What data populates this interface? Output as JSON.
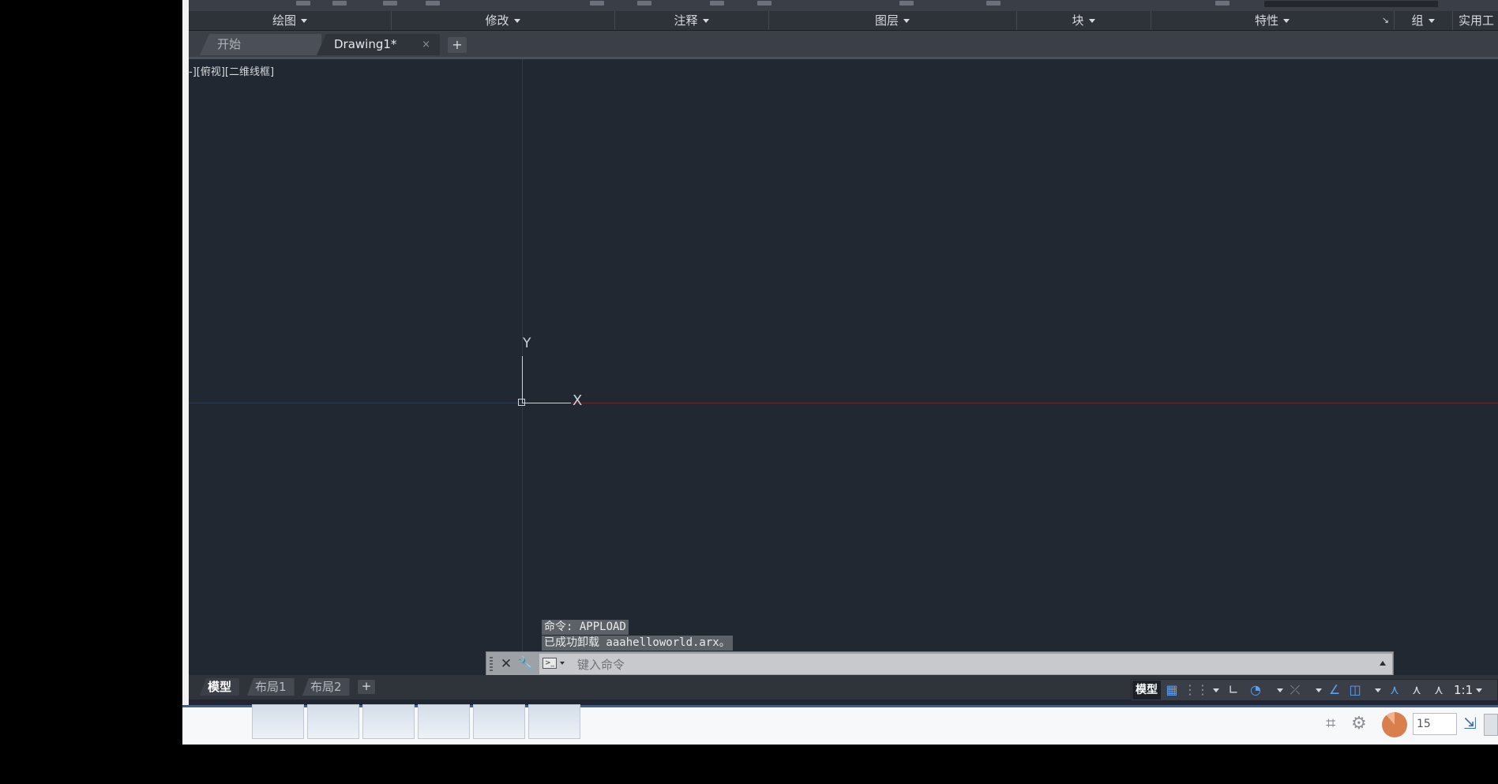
{
  "ribbon": {
    "panels": [
      {
        "label": "绘图"
      },
      {
        "label": "修改"
      },
      {
        "label": "注释"
      },
      {
        "label": "图层"
      },
      {
        "label": "块"
      },
      {
        "label": "特性"
      },
      {
        "label": "组"
      },
      {
        "label": "实用工"
      }
    ]
  },
  "tabs": {
    "start": "开始",
    "drawing": "Drawing1*",
    "close_glyph": "×",
    "add_glyph": "+"
  },
  "viewport": {
    "label": "-][俯视][二维线框]",
    "ucs_y": "Y",
    "ucs_x": "X"
  },
  "command": {
    "history": [
      "命令: APPLOAD",
      "已成功卸载 aaahelloworld.arx。"
    ],
    "placeholder": "键入命令",
    "value": ""
  },
  "layout_tabs": [
    "模型",
    "布局1",
    "布局2"
  ],
  "statusbar": {
    "model": "模型",
    "scale": "1:1"
  },
  "taskbar": {
    "counter": "15"
  },
  "colors": {
    "viewport_bg": "#212832",
    "x_axis": "#6b2a30",
    "y_axis": "#23433a",
    "accent": "#5aa0f5"
  }
}
